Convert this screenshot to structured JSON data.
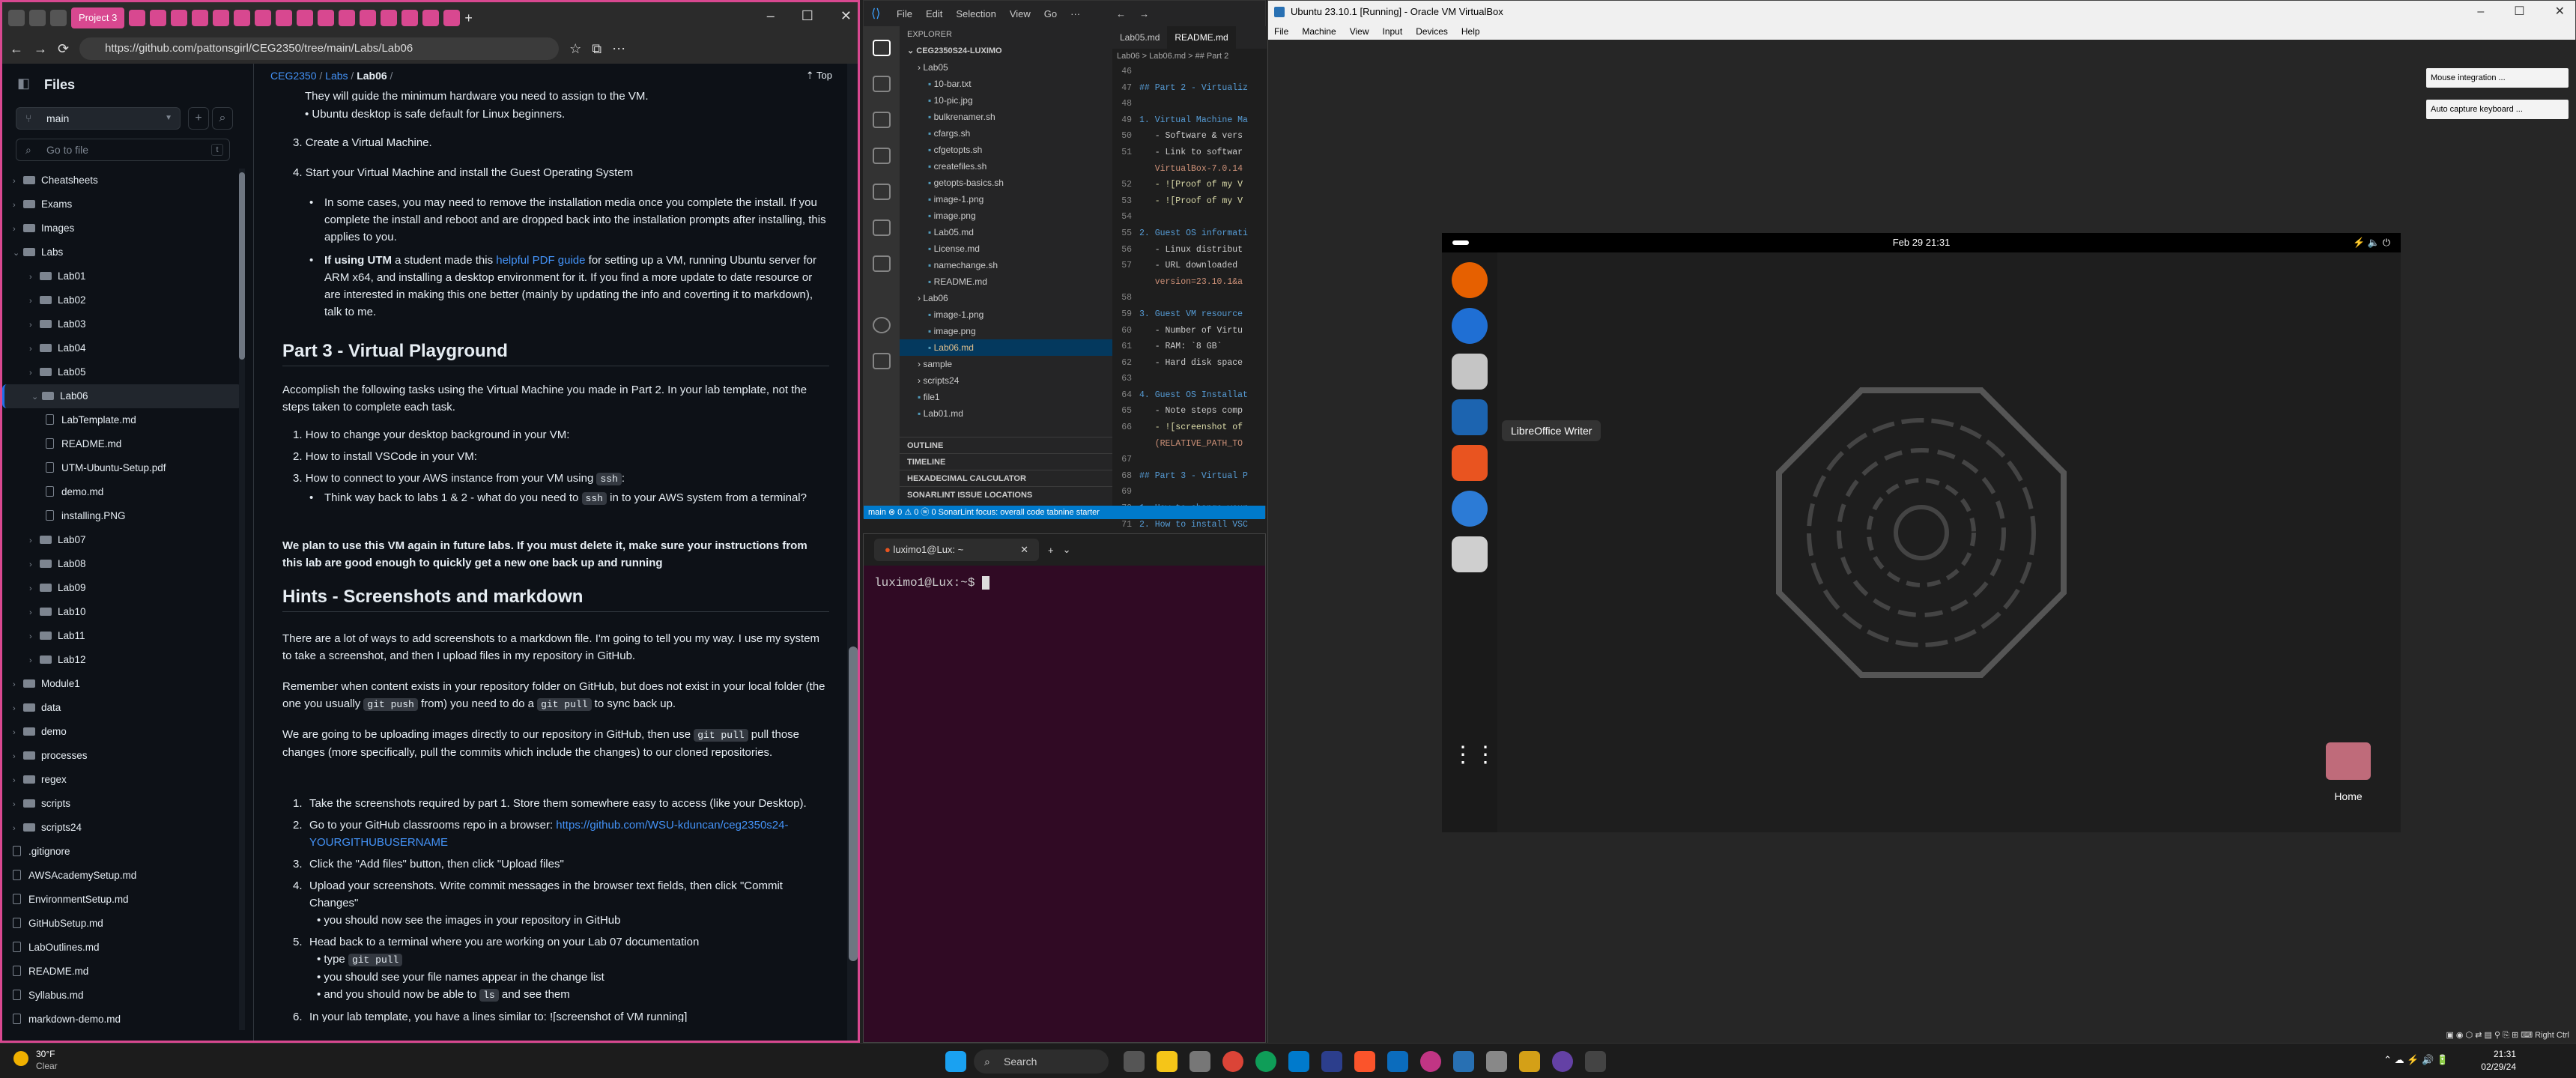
{
  "browser": {
    "tab_active_label": "Project 3",
    "url": "https://github.com/pattonsgirl/CEG2350/tree/main/Labs/Lab06",
    "files_title": "Files",
    "branch": "main",
    "goto_placeholder": "Go to file",
    "goto_shortcut": "t",
    "breadcrumb": {
      "repo": "CEG2350",
      "sep1": "/",
      "folder": "Labs",
      "sep2": "/",
      "current": "Lab06",
      "sep3": "/"
    },
    "top_button": "Top",
    "tree": [
      {
        "label": "Cheatsheets",
        "type": "folder",
        "depth": 0
      },
      {
        "label": "Exams",
        "type": "folder",
        "depth": 0
      },
      {
        "label": "Images",
        "type": "folder",
        "depth": 0
      },
      {
        "label": "Labs",
        "type": "folder",
        "depth": 0,
        "open": true
      },
      {
        "label": "Lab01",
        "type": "folder",
        "depth": 1
      },
      {
        "label": "Lab02",
        "type": "folder",
        "depth": 1
      },
      {
        "label": "Lab03",
        "type": "folder",
        "depth": 1
      },
      {
        "label": "Lab04",
        "type": "folder",
        "depth": 1
      },
      {
        "label": "Lab05",
        "type": "folder",
        "depth": 1
      },
      {
        "label": "Lab06",
        "type": "folder",
        "depth": 1,
        "open": true,
        "selected": true
      },
      {
        "label": "LabTemplate.md",
        "type": "file",
        "depth": 2
      },
      {
        "label": "README.md",
        "type": "file",
        "depth": 2
      },
      {
        "label": "UTM-Ubuntu-Setup.pdf",
        "type": "file",
        "depth": 2
      },
      {
        "label": "demo.md",
        "type": "file",
        "depth": 2
      },
      {
        "label": "installing.PNG",
        "type": "file",
        "depth": 2
      },
      {
        "label": "Lab07",
        "type": "folder",
        "depth": 1
      },
      {
        "label": "Lab08",
        "type": "folder",
        "depth": 1
      },
      {
        "label": "Lab09",
        "type": "folder",
        "depth": 1
      },
      {
        "label": "Lab10",
        "type": "folder",
        "depth": 1
      },
      {
        "label": "Lab11",
        "type": "folder",
        "depth": 1
      },
      {
        "label": "Lab12",
        "type": "folder",
        "depth": 1
      },
      {
        "label": "Module1",
        "type": "folder",
        "depth": 0
      },
      {
        "label": "data",
        "type": "folder",
        "depth": 0
      },
      {
        "label": "demo",
        "type": "folder",
        "depth": 0
      },
      {
        "label": "processes",
        "type": "folder",
        "depth": 0
      },
      {
        "label": "regex",
        "type": "folder",
        "depth": 0
      },
      {
        "label": "scripts",
        "type": "folder",
        "depth": 0
      },
      {
        "label": "scripts24",
        "type": "folder",
        "depth": 0
      },
      {
        "label": ".gitignore",
        "type": "file",
        "depth": 0
      },
      {
        "label": "AWSAcademySetup.md",
        "type": "file",
        "depth": 0
      },
      {
        "label": "EnvironmentSetup.md",
        "type": "file",
        "depth": 0
      },
      {
        "label": "GitHubSetup.md",
        "type": "file",
        "depth": 0
      },
      {
        "label": "LabOutlines.md",
        "type": "file",
        "depth": 0
      },
      {
        "label": "README.md",
        "type": "file",
        "depth": 0
      },
      {
        "label": "Syllabus.md",
        "type": "file",
        "depth": 0
      },
      {
        "label": "markdown-demo.md",
        "type": "file",
        "depth": 0
      }
    ],
    "md": {
      "p_top1": "They will guide the minimum hardware you need to assign to the VM.",
      "p_top2": "Ubuntu desktop is safe default for Linux beginners.",
      "step3": "Create a Virtual Machine.",
      "step4": "Start your Virtual Machine and install the Guest Operating System",
      "bullet1": "In some cases, you may need to remove the installation media once you complete the install. If you complete the install and reboot and are dropped back into the installation prompts after installing, this applies to you.",
      "bullet2_bold": "If using UTM",
      "bullet2_pre": " a student made this ",
      "bullet2_link": "helpful PDF guide",
      "bullet2_post": " for setting up a VM, running Ubuntu server for ARM x64, and installing a desktop environment for it. If you find a more update to date resource or are interested in making this one better (mainly by updating the info and coverting it to markdown), talk to me.",
      "h_part3": "Part 3 - Virtual Playground",
      "p_part3": "Accomplish the following tasks using the Virtual Machine you made in Part 2. In your lab template, not the steps taken to complete each task.",
      "task1": "How to change your desktop background in your VM:",
      "task2": "How to install VSCode in your VM:",
      "task3_pre": "How to connect to your AWS instance from your VM using ",
      "task3_code": "ssh",
      "task3_post": ":",
      "task3_sub_pre": "Think way back to labs 1 & 2 - what do you need to ",
      "task3_sub_code": "ssh",
      "task3_sub_post": " in to your AWS system from a terminal?",
      "bold_note": "We plan to use this VM again in future labs. If you must delete it, make sure your instructions from this lab are good enough to quickly get a new one back up and running",
      "h_hints": "Hints - Screenshots and markdown",
      "hint1": "There are a lot of ways to add screenshots to a markdown file. I'm going to tell you my way. I use my system to take a screenshot, and then I upload files in my repository in GitHub.",
      "hint2_pre": "Remember when content exists in your repository folder on GitHub, but does not exist in your local folder (the one you usually ",
      "hint2_code1": "git push",
      "hint2_mid": " from) you need to do a ",
      "hint2_code2": "git pull",
      "hint2_post": " to sync back up.",
      "hint3_pre": "We are going to be uploading images directly to our repository in GitHub, then use ",
      "hint3_code": "git pull",
      "hint3_post": " pull those changes (more specifically, pull the commits which include the changes) to our cloned repositories.",
      "s1": "Take the screenshots required by part 1. Store them somewhere easy to access (like your Desktop).",
      "s2_pre": "Go to your GitHub classrooms repo in a browser: ",
      "s2_link": "https://github.com/WSU-kduncan/ceg2350s24-YOURGITHUBUSERNAME",
      "s3": "Click the \"Add files\" button, then click \"Upload files\"",
      "s4": "Upload your screenshots. Write commit messages in the browser text fields, then click \"Commit Changes\"",
      "s4_sub": "you should now see the images in your repository in GitHub",
      "s5": "Head back to a terminal where you are working on your Lab 07 documentation",
      "s5_sub1_pre": "type ",
      "s5_sub1_code": "git pull",
      "s5_sub2": "you should see your file names appear in the change list",
      "s5_sub3_pre": "and you should now be able to ",
      "s5_sub3_code": "ls",
      "s5_sub3_post": " and see them",
      "s6": "In your lab template, you have a lines similar to: ![screenshot of VM running]"
    }
  },
  "vscode": {
    "menu": [
      "File",
      "Edit",
      "Selection",
      "View",
      "Go",
      "···"
    ],
    "explorer_title": "EXPLORER",
    "workspace": "CEG2350S24-LUXIMO",
    "items": [
      {
        "label": "Lab05",
        "kind": "folder",
        "indent": 1
      },
      {
        "label": "10-bar.txt",
        "kind": "file",
        "indent": 2
      },
      {
        "label": "10-pic.jpg",
        "kind": "file",
        "indent": 2
      },
      {
        "label": "bulkrenamer.sh",
        "kind": "file",
        "indent": 2
      },
      {
        "label": "cfargs.sh",
        "kind": "file",
        "indent": 2
      },
      {
        "label": "cfgetopts.sh",
        "kind": "file",
        "indent": 2
      },
      {
        "label": "createfiles.sh",
        "kind": "file",
        "indent": 2
      },
      {
        "label": "getopts-basics.sh",
        "kind": "file",
        "indent": 2
      },
      {
        "label": "image-1.png",
        "kind": "file",
        "indent": 2
      },
      {
        "label": "image.png",
        "kind": "file",
        "indent": 2
      },
      {
        "label": "Lab05.md",
        "kind": "file",
        "indent": 2
      },
      {
        "label": "License.md",
        "kind": "file",
        "indent": 2
      },
      {
        "label": "namechange.sh",
        "kind": "file",
        "indent": 2
      },
      {
        "label": "README.md",
        "kind": "file",
        "indent": 2
      },
      {
        "label": "Lab06",
        "kind": "folder",
        "indent": 1
      },
      {
        "label": "image-1.png",
        "kind": "file",
        "indent": 2
      },
      {
        "label": "image.png",
        "kind": "file",
        "indent": 2
      },
      {
        "label": "Lab06.md",
        "kind": "file",
        "indent": 2,
        "selected": true
      },
      {
        "label": "sample",
        "kind": "folder",
        "indent": 1
      },
      {
        "label": "scripts24",
        "kind": "folder",
        "indent": 1
      },
      {
        "label": "file1",
        "kind": "file",
        "indent": 1
      },
      {
        "label": "Lab01.md",
        "kind": "file",
        "indent": 1
      }
    ],
    "sections": [
      "OUTLINE",
      "TIMELINE",
      "HEXADECIMAL CALCULATOR",
      "SONARLINT ISSUE LOCATIONS"
    ],
    "tabs": [
      "Lab05.md",
      "README.md"
    ],
    "breadcrumb": "Lab06 > Lab06.md > ## Part 2",
    "code": [
      {
        "n": "46",
        "t": ""
      },
      {
        "n": "47",
        "t": "## Part 2 - Virtualiz",
        "c": "h"
      },
      {
        "n": "48",
        "t": ""
      },
      {
        "n": "49",
        "t": "1. Virtual Machine Ma",
        "c": "h"
      },
      {
        "n": "50",
        "t": "   - Software & vers",
        "c": ""
      },
      {
        "n": "51",
        "t": "   - Link to softwar",
        "c": ""
      },
      {
        "n": "",
        "t": "   VirtualBox-7.0.14",
        "c": "o"
      },
      {
        "n": "52",
        "t": "   - ![Proof of my V",
        "c": "y"
      },
      {
        "n": "53",
        "t": "   - ![Proof of my V",
        "c": "y"
      },
      {
        "n": "54",
        "t": ""
      },
      {
        "n": "55",
        "t": "2. Guest OS informati",
        "c": "h"
      },
      {
        "n": "56",
        "t": "   - Linux distribut",
        "c": ""
      },
      {
        "n": "57",
        "t": "   - URL downloaded",
        "c": ""
      },
      {
        "n": "",
        "t": "   version=23.10.1&a",
        "c": "o"
      },
      {
        "n": "58",
        "t": ""
      },
      {
        "n": "59",
        "t": "3. Guest VM resource",
        "c": "h"
      },
      {
        "n": "60",
        "t": "   - Number of Virtu",
        "c": ""
      },
      {
        "n": "61",
        "t": "   - RAM: `8 GB`",
        "c": ""
      },
      {
        "n": "62",
        "t": "   - Hard disk space",
        "c": ""
      },
      {
        "n": "63",
        "t": ""
      },
      {
        "n": "64",
        "t": "4. Guest OS Installat",
        "c": "h"
      },
      {
        "n": "65",
        "t": "   - Note steps comp",
        "c": ""
      },
      {
        "n": "66",
        "t": "   - ![screenshot of",
        "c": "y"
      },
      {
        "n": "",
        "t": "   (RELATIVE_PATH_TO",
        "c": "o"
      },
      {
        "n": "67",
        "t": ""
      },
      {
        "n": "68",
        "t": "## Part 3 - Virtual P",
        "c": "h"
      },
      {
        "n": "69",
        "t": ""
      },
      {
        "n": "70",
        "t": "1. How to change your",
        "c": "h"
      },
      {
        "n": "71",
        "t": "2. How to install VSC",
        "c": "h"
      },
      {
        "n": "72",
        "t": "3. How to connect to",
        "c": "h"
      }
    ],
    "status": "main   ⊗ 0 ⚠ 0   ⓦ 0   SonarLint focus: overall code   tabnine starter"
  },
  "terminal": {
    "tab_title": "luximo1@Lux: ~",
    "prompt": "luximo1@Lux:~$"
  },
  "virtualbox": {
    "title": "Ubuntu 23.10.1 [Running] - Oracle VM VirtualBox",
    "menu": [
      "File",
      "Machine",
      "View",
      "Input",
      "Devices",
      "Help"
    ],
    "notes": [
      "Mouse integration ...",
      "Auto capture keyboard ..."
    ],
    "gnome_clock": "Feb 29  21:31",
    "tooltip": "LibreOffice Writer",
    "home_label": "Home",
    "status_key": "Right Ctrl"
  },
  "taskbar": {
    "temp": "30°F",
    "weather": "Clear",
    "search": "Search",
    "time": "21:31",
    "date": "02/29/24"
  },
  "colors": {
    "browser_frame": "#d84890",
    "github_link": "#4493f8",
    "vscode_status": "#007acc",
    "terminal_bg": "#300a24"
  }
}
